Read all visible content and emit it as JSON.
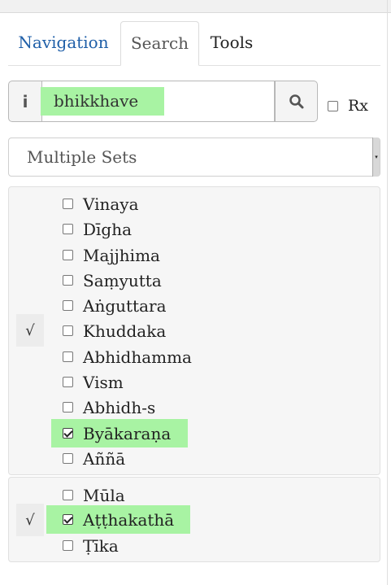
{
  "tabs": [
    {
      "label": "Navigation"
    },
    {
      "label": "Search"
    },
    {
      "label": "Tools"
    }
  ],
  "search": {
    "query": "bhikkhave",
    "info_label": "i",
    "rx_label": "Rx",
    "rx_checked": false
  },
  "dropdown": {
    "selected": "Multiple Sets"
  },
  "groups": [
    {
      "toggle": "√",
      "items": [
        {
          "label": "Vinaya",
          "checked": false
        },
        {
          "label": "Dīgha",
          "checked": false
        },
        {
          "label": "Majjhima",
          "checked": false
        },
        {
          "label": "Saṃyutta",
          "checked": false
        },
        {
          "label": "Aṅguttara",
          "checked": false
        },
        {
          "label": "Khuddaka",
          "checked": false
        },
        {
          "label": "Abhidhamma",
          "checked": false
        },
        {
          "label": "Vism",
          "checked": false
        },
        {
          "label": "Abhidh-s",
          "checked": false
        },
        {
          "label": "Byākaraṇa",
          "checked": true
        },
        {
          "label": "Aññā",
          "checked": false
        }
      ]
    },
    {
      "toggle": "√",
      "items": [
        {
          "label": "Mūla",
          "checked": false
        },
        {
          "label": "Aṭṭhakathā",
          "checked": true
        },
        {
          "label": "Ṭīka",
          "checked": false
        }
      ]
    }
  ],
  "colors": {
    "highlight": "#a8f3a3",
    "link": "#1f5fa8"
  },
  "icons": {
    "search": "magnifier-icon",
    "info": "info-icon"
  }
}
